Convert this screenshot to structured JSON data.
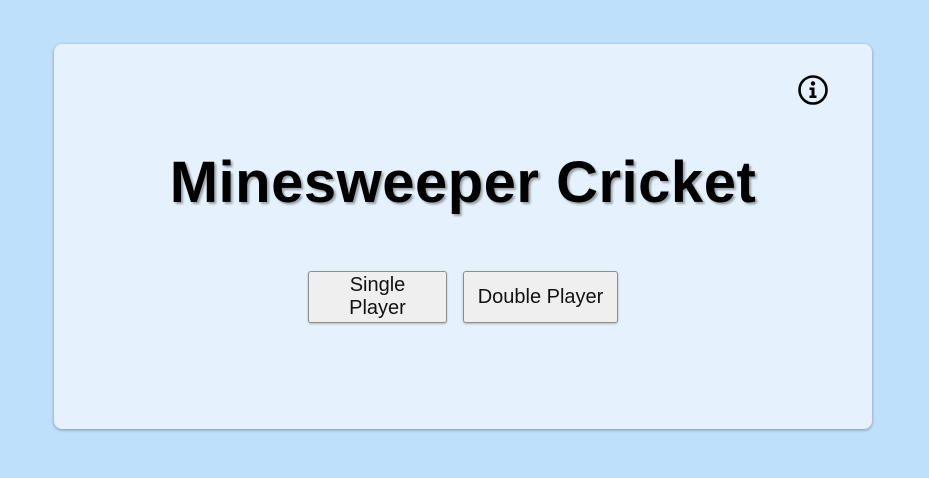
{
  "app": {
    "title": "Minesweeper Cricket"
  },
  "toolbar": {
    "info_icon": "info-icon"
  },
  "menu": {
    "single_player_label": "Single Player",
    "double_player_label": "Double Player"
  },
  "colors": {
    "page_background": "#bee0fb",
    "card_background": "#e5f2fd",
    "button_background": "#efefef"
  }
}
